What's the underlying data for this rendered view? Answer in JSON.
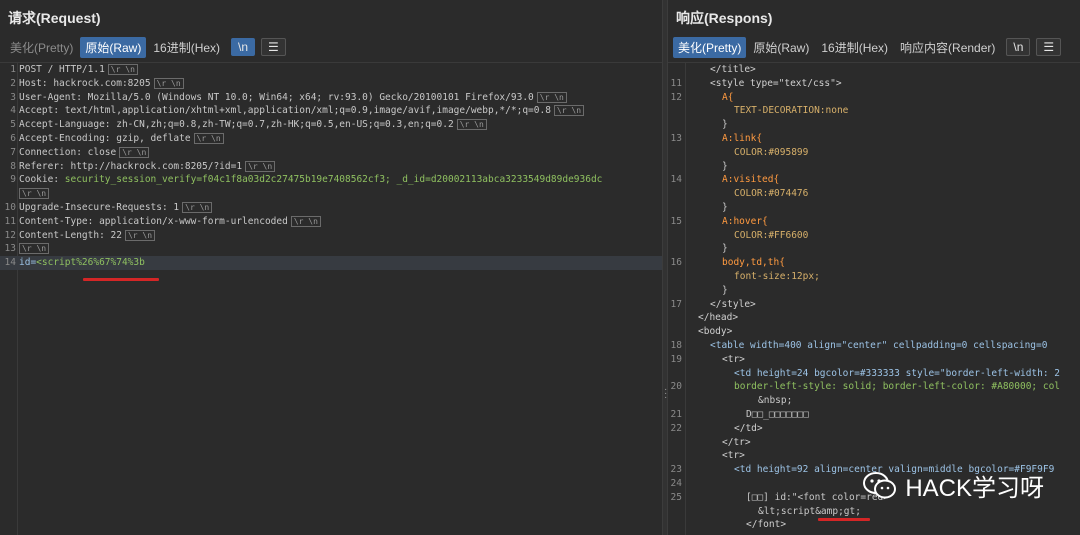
{
  "request": {
    "title": "请求(Request)",
    "tabs": [
      "美化(Pretty)",
      "原始(Raw)",
      "16进制(Hex)"
    ],
    "active_tab": "原始(Raw)",
    "newline_button": "\\n",
    "menu_icon": "hamburger-icon",
    "lines": [
      {
        "n": "1",
        "text": "POST / HTTP/1.1"
      },
      {
        "n": "2",
        "text": "Host: hackrock.com:8205"
      },
      {
        "n": "3",
        "text": "User-Agent: Mozilla/5.0 (Windows NT 10.0; Win64; x64; rv:93.0) Gecko/20100101 Firefox/93.0"
      },
      {
        "n": "4",
        "text": "Accept: text/html,application/xhtml+xml,application/xml;q=0.9,image/avif,image/webp,*/*;q=0.8"
      },
      {
        "n": "5",
        "text": "Accept-Language: zh-CN,zh;q=0.8,zh-TW;q=0.7,zh-HK;q=0.5,en-US;q=0.3,en;q=0.2"
      },
      {
        "n": "6",
        "text": "Accept-Encoding: gzip, deflate"
      },
      {
        "n": "7",
        "text": "Connection: close"
      },
      {
        "n": "8",
        "text": "Referer: http://hackrock.com:8205/?id=1"
      },
      {
        "n": "9",
        "key": "Cookie: ",
        "text": "security_session_verify=f04c1f8a03d2c27475b19e7408562cf3; _d_id=d20002113abca3233549d89de936dc"
      },
      {
        "n": "",
        "text": ""
      },
      {
        "n": "10",
        "text": "Upgrade-Insecure-Requests: 1"
      },
      {
        "n": "11",
        "text": "Content-Type: application/x-www-form-urlencoded"
      },
      {
        "n": "12",
        "text": "Content-Length: 22"
      },
      {
        "n": "13",
        "text": ""
      },
      {
        "n": "14",
        "key": "id=",
        "text": "<script%26%67%74%3b"
      }
    ],
    "crlf_label": "\\r \\n"
  },
  "response": {
    "title": "响应(Respons)",
    "tabs": [
      "美化(Pretty)",
      "原始(Raw)",
      "16进制(Hex)",
      "响应内容(Render)"
    ],
    "active_tab": "美化(Pretty)",
    "newline_button": "\\n",
    "menu_icon": "hamburger-icon",
    "lines": [
      {
        "n": "",
        "text": "</title>"
      },
      {
        "n": "11",
        "text": "<style type=\"text/css\">"
      },
      {
        "n": "12",
        "text": "A{"
      },
      {
        "n": "",
        "text": "TEXT-DECORATION:none"
      },
      {
        "n": "",
        "text": "}"
      },
      {
        "n": "13",
        "text": "A:link{"
      },
      {
        "n": "",
        "text": "COLOR:#095899"
      },
      {
        "n": "",
        "text": "}"
      },
      {
        "n": "14",
        "text": "A:visited{"
      },
      {
        "n": "",
        "text": "COLOR:#074476"
      },
      {
        "n": "",
        "text": "}"
      },
      {
        "n": "15",
        "text": "A:hover{"
      },
      {
        "n": "",
        "text": "COLOR:#FF6600"
      },
      {
        "n": "",
        "text": "}"
      },
      {
        "n": "16",
        "text": "body,td,th{"
      },
      {
        "n": "",
        "text": "font-size:12px;"
      },
      {
        "n": "",
        "text": "}"
      },
      {
        "n": "17",
        "text": "</style>"
      },
      {
        "n": "",
        "text": "</head>"
      },
      {
        "n": "",
        "text": "<body>"
      },
      {
        "n": "18",
        "text": "<table width=400 align=\"center\" cellpadding=0 cellspacing=0"
      },
      {
        "n": "19",
        "text": "<tr>"
      },
      {
        "n": "",
        "text": "<td height=24 bgcolor=#333333 style=\"border-left-width: 2"
      },
      {
        "n": "20",
        "text": "border-left-style: solid; border-left-color: #A80000; col"
      },
      {
        "n": "",
        "text": "&nbsp;"
      },
      {
        "n": "21",
        "text": "D□□_□□□□□□□"
      },
      {
        "n": "22",
        "text": "</td>"
      },
      {
        "n": "",
        "text": "</tr>"
      },
      {
        "n": "",
        "text": "<tr>"
      },
      {
        "n": "23",
        "text": "<td height=92 align=center valign=middle bgcolor=#F9F9F9"
      },
      {
        "n": "24",
        "text": ""
      },
      {
        "n": "25",
        "text": "[□□] id:\"<font color=red>"
      },
      {
        "n": "",
        "text": "&lt;script&amp;gt;"
      },
      {
        "n": "",
        "text": "</font>"
      }
    ]
  },
  "watermark": {
    "text": "HACK学习呀",
    "icon": "wechat-icon"
  }
}
